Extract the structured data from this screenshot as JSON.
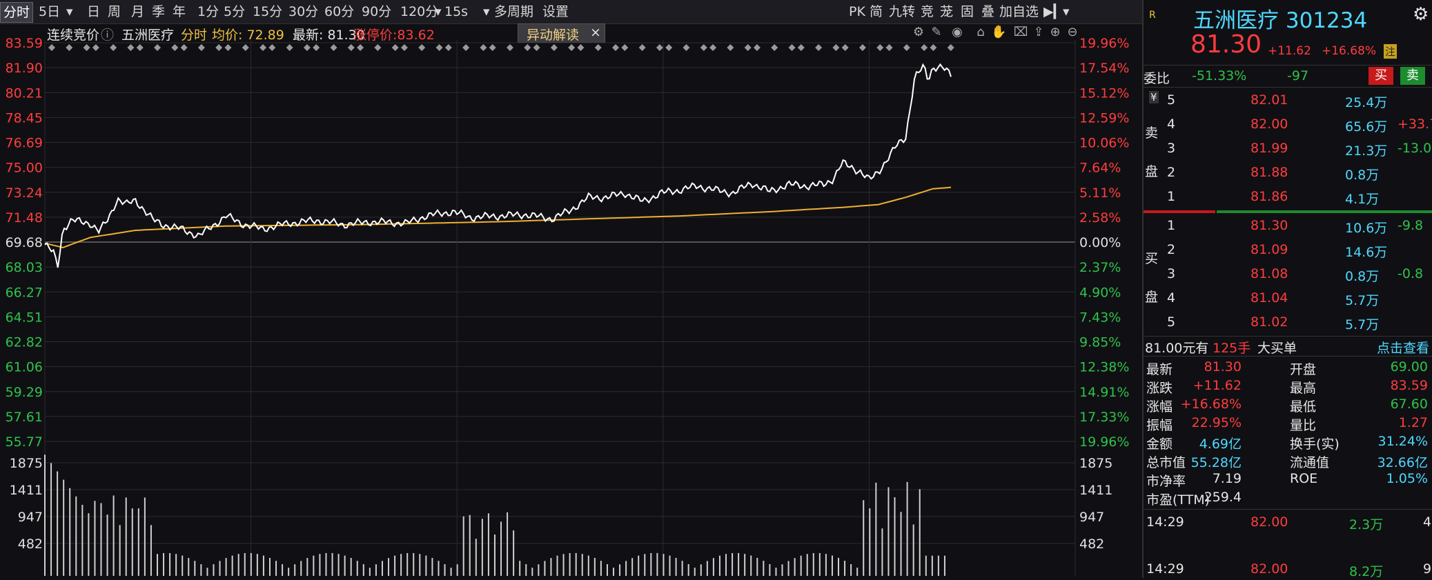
{
  "toolbar": {
    "tabs": [
      "分时",
      "5日",
      "日",
      "周",
      "月",
      "季",
      "年",
      "1分",
      "5分",
      "15分",
      "30分",
      "60分",
      "90分",
      "120分",
      "15s",
      "多周期",
      "设置"
    ],
    "right_items": [
      "PK",
      "简",
      "九转",
      "竞",
      "茏",
      "固",
      "叠",
      "加自选"
    ]
  },
  "info": {
    "session": "连续竞价",
    "name": "五洲医疗",
    "mode": "分时",
    "avg_label": "均价: 72.89",
    "last_label": "最新: 81.30",
    "limit_label": "涨停价:83.62",
    "popup_label": "异动解读",
    "popup_close": "×"
  },
  "chart_data": {
    "type": "line",
    "ylim": [
      55.77,
      83.59
    ],
    "prev_close": 69.68,
    "price_ticks": [
      "83.59",
      "81.90",
      "80.21",
      "78.45",
      "76.69",
      "75.00",
      "73.24",
      "71.48",
      "69.68",
      "68.03",
      "66.27",
      "64.51",
      "62.82",
      "61.06",
      "59.29",
      "57.61",
      "55.77"
    ],
    "pct_ticks": [
      "19.96%",
      "17.54%",
      "15.12%",
      "12.59%",
      "10.06%",
      "7.64%",
      "5.11%",
      "2.58%",
      "0.00%",
      "2.37%",
      "4.90%",
      "7.43%",
      "9.85%",
      "12.38%",
      "14.91%",
      "17.33%",
      "19.96%"
    ],
    "vol_ticks": [
      "1875",
      "1411",
      "947",
      "482"
    ],
    "colors": {
      "price": "#ffffff",
      "avg": "#f0b030",
      "up": "#ff3d3d",
      "down": "#2fc24a",
      "flat": "#e0e0e0",
      "grid": "#2a2a30",
      "vol": "#d0d0d0",
      "marker": "#9a9a9a"
    }
  },
  "stock": {
    "logo": "R",
    "title": "五洲医疗 301234",
    "price": "81.30",
    "change": "+11.62",
    "change_pct": "+16.68%",
    "badge": "注"
  },
  "ratio": {
    "label": "委比",
    "pct": "-51.33%",
    "diff": "-97",
    "buy": "买",
    "sell": "卖"
  },
  "orderbook": {
    "sell_label": [
      "卖",
      "盘"
    ],
    "buy_label": [
      "买",
      "盘"
    ],
    "yen": "¥",
    "asks": [
      {
        "lvl": "5",
        "price": "82.01",
        "vol": "25.4万",
        "chg": ""
      },
      {
        "lvl": "4",
        "price": "82.00",
        "vol": "65.6万",
        "chg": "+33.7"
      },
      {
        "lvl": "3",
        "price": "81.99",
        "vol": "21.3万",
        "chg": "-13.0"
      },
      {
        "lvl": "2",
        "price": "81.88",
        "vol": "0.8万",
        "chg": ""
      },
      {
        "lvl": "1",
        "price": "81.86",
        "vol": "4.1万",
        "chg": ""
      }
    ],
    "bids": [
      {
        "lvl": "1",
        "price": "81.30",
        "vol": "10.6万",
        "chg": "-9.8"
      },
      {
        "lvl": "2",
        "price": "81.09",
        "vol": "14.6万",
        "chg": ""
      },
      {
        "lvl": "3",
        "price": "81.08",
        "vol": "0.8万",
        "chg": "-0.8"
      },
      {
        "lvl": "4",
        "price": "81.04",
        "vol": "5.7万",
        "chg": ""
      },
      {
        "lvl": "5",
        "price": "81.02",
        "vol": "5.7万",
        "chg": ""
      }
    ]
  },
  "bigorder": {
    "a": "81.00元有",
    "b": "125手",
    "c": "大买单",
    "link": "点击查看"
  },
  "stats": [
    {
      "k1": "最新",
      "v1": "81.30",
      "c1": "red",
      "k2": "开盘",
      "v2": "69.00",
      "c2": "green"
    },
    {
      "k1": "涨跌",
      "v1": "+11.62",
      "c1": "red",
      "k2": "最高",
      "v2": "83.59",
      "c2": "red"
    },
    {
      "k1": "涨幅",
      "v1": "+16.68%",
      "c1": "red",
      "k2": "最低",
      "v2": "67.60",
      "c2": "green"
    },
    {
      "k1": "振幅",
      "v1": "22.95%",
      "c1": "red",
      "k2": "量比",
      "v2": "1.27",
      "c2": "red"
    },
    {
      "k1": "金额",
      "v1": "4.69亿",
      "c1": "cyan",
      "k2": "换手(实)",
      "v2": "31.24%",
      "c2": "cyan"
    },
    {
      "k1": "总市值",
      "v1": "55.28亿",
      "c1": "cyan",
      "k2": "流通值",
      "v2": "32.66亿",
      "c2": "cyan"
    },
    {
      "k1": "市净率",
      "v1": "7.19",
      "c1": "white",
      "k2": "ROE",
      "v2": "1.05%",
      "c2": "cyan"
    },
    {
      "k1": "市盈(TTM)",
      "v1": "259.4",
      "c1": "white",
      "k2": "",
      "v2": "",
      "c2": "white"
    }
  ],
  "ticks": [
    {
      "time": "14:29",
      "price": "82.00",
      "vol": "2.3万",
      "n": "4"
    },
    {
      "time": "14:29",
      "price": "82.00",
      "vol": "8.2万",
      "n": "9"
    }
  ]
}
